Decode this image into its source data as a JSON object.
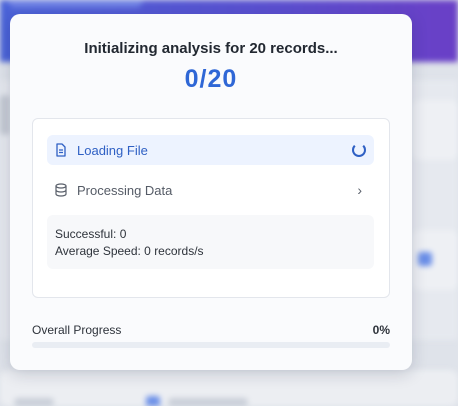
{
  "modal": {
    "title": "Initializing analysis for 20 records...",
    "counter": "0/20",
    "steps": [
      {
        "label": "Loading File",
        "icon": "file-icon",
        "status": "active"
      },
      {
        "label": "Processing Data",
        "icon": "database-icon",
        "status": "pending"
      }
    ],
    "stats": {
      "successful": "Successful: 0",
      "speed": "Average Speed: 0 records/s"
    },
    "progress": {
      "label": "Overall Progress",
      "percent_text": "0%",
      "value": 0
    }
  },
  "colors": {
    "accent": "#2f67d6",
    "active_step_bg": "#edf3ff"
  }
}
